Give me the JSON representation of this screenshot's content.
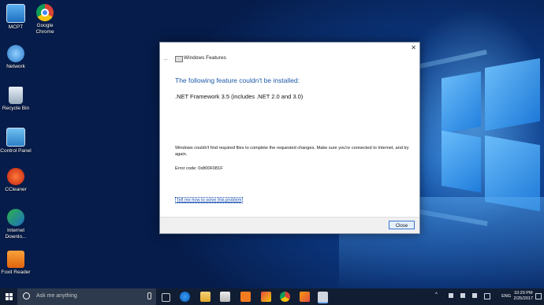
{
  "desktop": {
    "icons": [
      {
        "label": "MCPT",
        "icon": "monitor-icon"
      },
      {
        "label": "Google Chrome",
        "icon": "chrome-icon"
      },
      {
        "label": "Network",
        "icon": "network-icon"
      },
      {
        "label": "Recycle Bin",
        "icon": "recycle-bin-icon"
      },
      {
        "label": "Control Panel",
        "icon": "control-panel-icon"
      },
      {
        "label": "CCleaner",
        "icon": "ccleaner-icon"
      },
      {
        "label": "Internet Downlo...",
        "icon": "idm-icon"
      },
      {
        "label": "Foxit Reader",
        "icon": "foxit-icon"
      }
    ]
  },
  "dialog": {
    "title": "Windows Features",
    "heading": "The following feature couldn't be installed:",
    "feature": ".NET Framework 3.5 (includes .NET 2.0 and 3.0)",
    "message": "Windows couldn't find required files to complete the requested changes. Make sure you're connected to Internet, and try again.",
    "error_code": "Error code: 0x800F081F",
    "help_link": "Tell me how to solve this problem",
    "close_label": "Close"
  },
  "taskbar": {
    "search_placeholder": "Ask me anything",
    "language": "ENG",
    "time": "10:29 PM",
    "date": "2/25/2017",
    "apps": [
      "task-view-icon",
      "edge-icon",
      "file-explorer-icon",
      "store-icon",
      "xampp-icon",
      "puzzle-app-icon",
      "chrome-icon",
      "windows-features-icon"
    ]
  },
  "colors": {
    "accent": "#1e5aa8",
    "taskbar": "#101d33",
    "link": "#1a4fb0"
  }
}
